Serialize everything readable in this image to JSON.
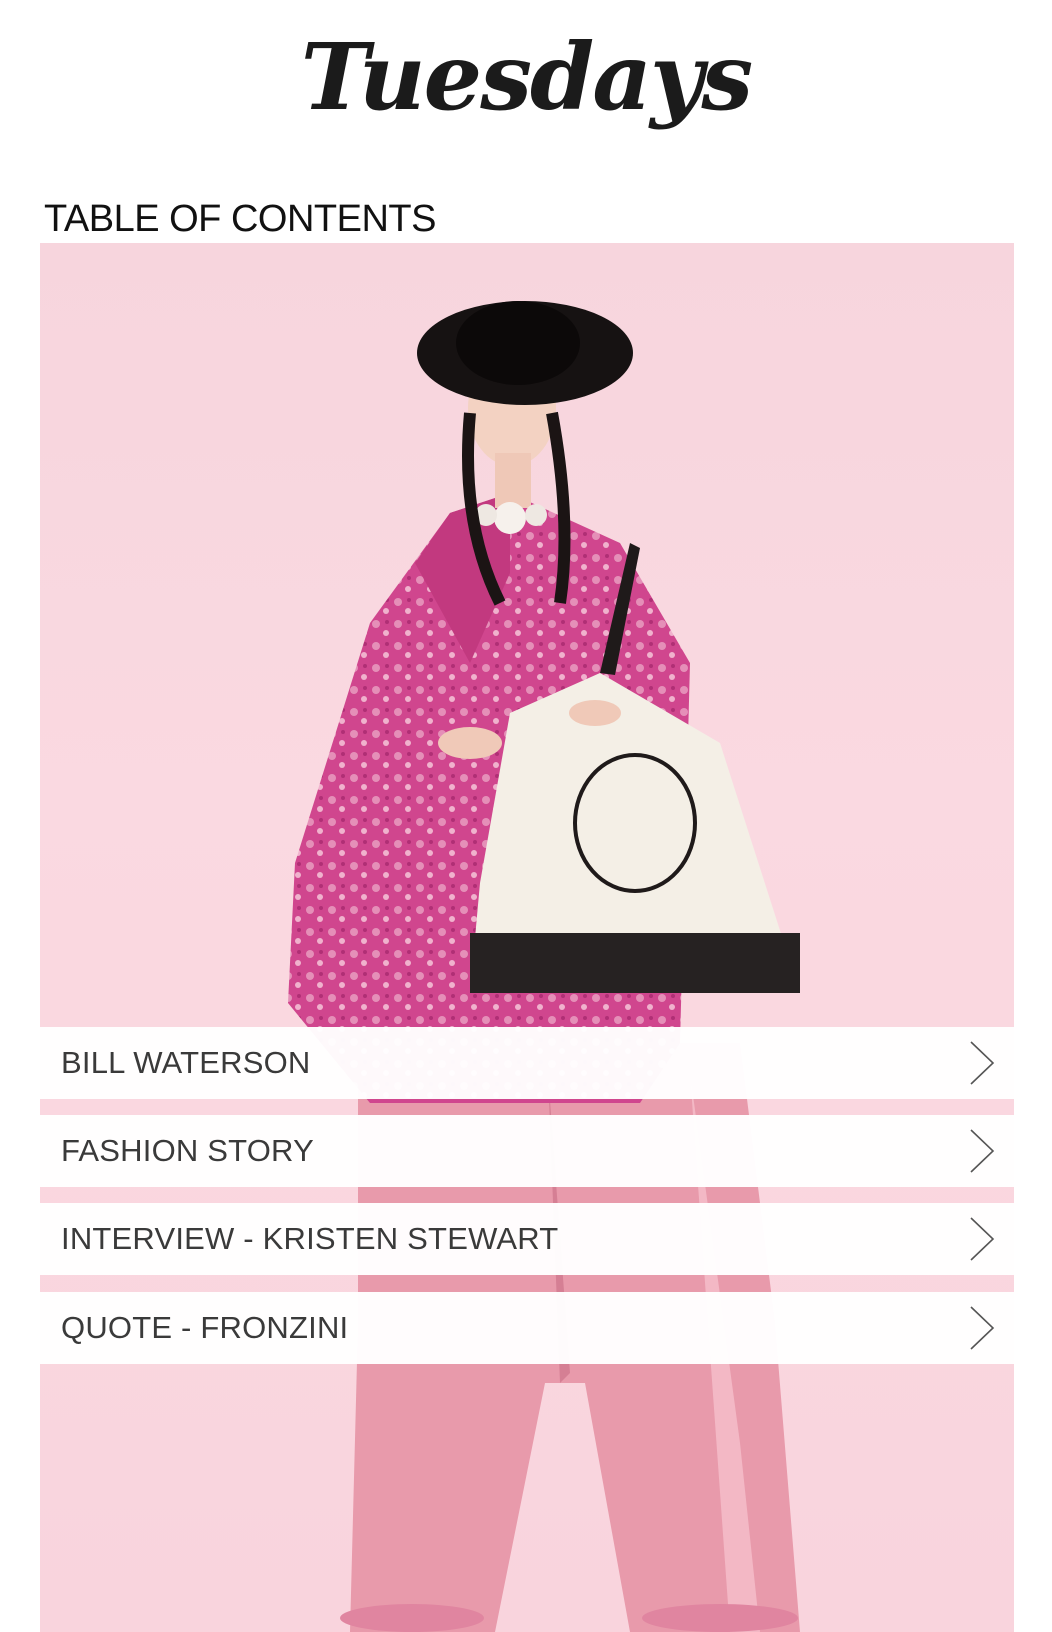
{
  "header": {
    "logo_text": "Tuesdays"
  },
  "toc": {
    "heading": "TABLE OF CONTENTS",
    "items": [
      {
        "label": "BILL WATERSON",
        "icon": "chevron-right-icon"
      },
      {
        "label": "FASHION STORY",
        "icon": "chevron-right-icon"
      },
      {
        "label": "INTERVIEW - KRISTEN STEWART",
        "icon": "chevron-right-icon"
      },
      {
        "label": "QUOTE - FRONZINI",
        "icon": "chevron-right-icon"
      }
    ]
  },
  "colors": {
    "background": "#ffffff",
    "hero_pink": "#f8d6de",
    "coat_magenta": "#c2397f",
    "trousers_pink": "#e89aab",
    "text_dark": "#111111",
    "item_text": "#3a3a3a"
  }
}
